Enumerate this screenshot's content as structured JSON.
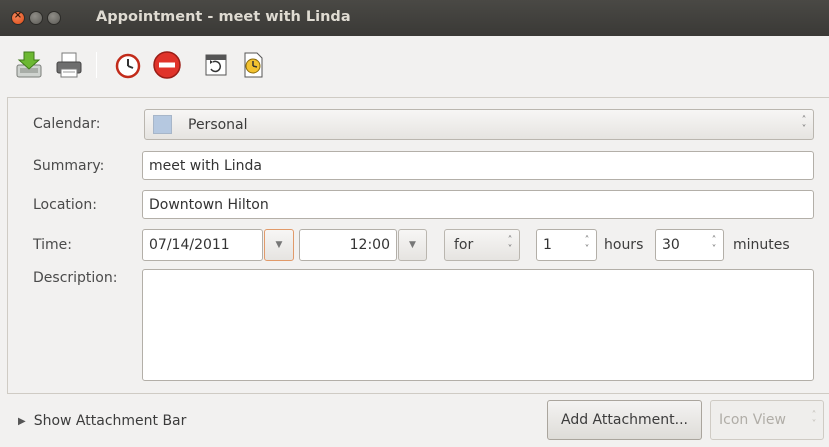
{
  "window": {
    "title": "Appointment - meet with Linda",
    "close_glyph": "×"
  },
  "toolbar": {
    "items": [
      {
        "name": "save-close-icon",
        "tooltip": "Save and Close"
      },
      {
        "name": "print-icon",
        "tooltip": "Print"
      },
      {
        "name": "alarm-clock-icon",
        "tooltip": "Reminders"
      },
      {
        "name": "busy-icon",
        "tooltip": "Show Time as Busy"
      },
      {
        "name": "recurrence-icon",
        "tooltip": "Recurrence"
      },
      {
        "name": "time-zone-icon",
        "tooltip": "Time Zone"
      }
    ]
  },
  "form": {
    "calendar": {
      "label": "Calendar:",
      "value": "Personal",
      "color": "#b5c8e0"
    },
    "summary": {
      "label": "Summary:",
      "value": "meet with Linda"
    },
    "location": {
      "label": "Location:",
      "value": "Downtown Hilton"
    },
    "time": {
      "label": "Time:",
      "date": "07/14/2011",
      "start": "12:00",
      "duration_mode": "for",
      "hours_value": "1",
      "hours_label": "hours",
      "minutes_value": "30",
      "minutes_label": "minutes"
    },
    "description": {
      "label": "Description:",
      "value": ""
    }
  },
  "bottom": {
    "show_attachment_bar": "Show Attachment Bar",
    "add_attachment": "Add Attachment...",
    "view_mode": "Icon View"
  }
}
